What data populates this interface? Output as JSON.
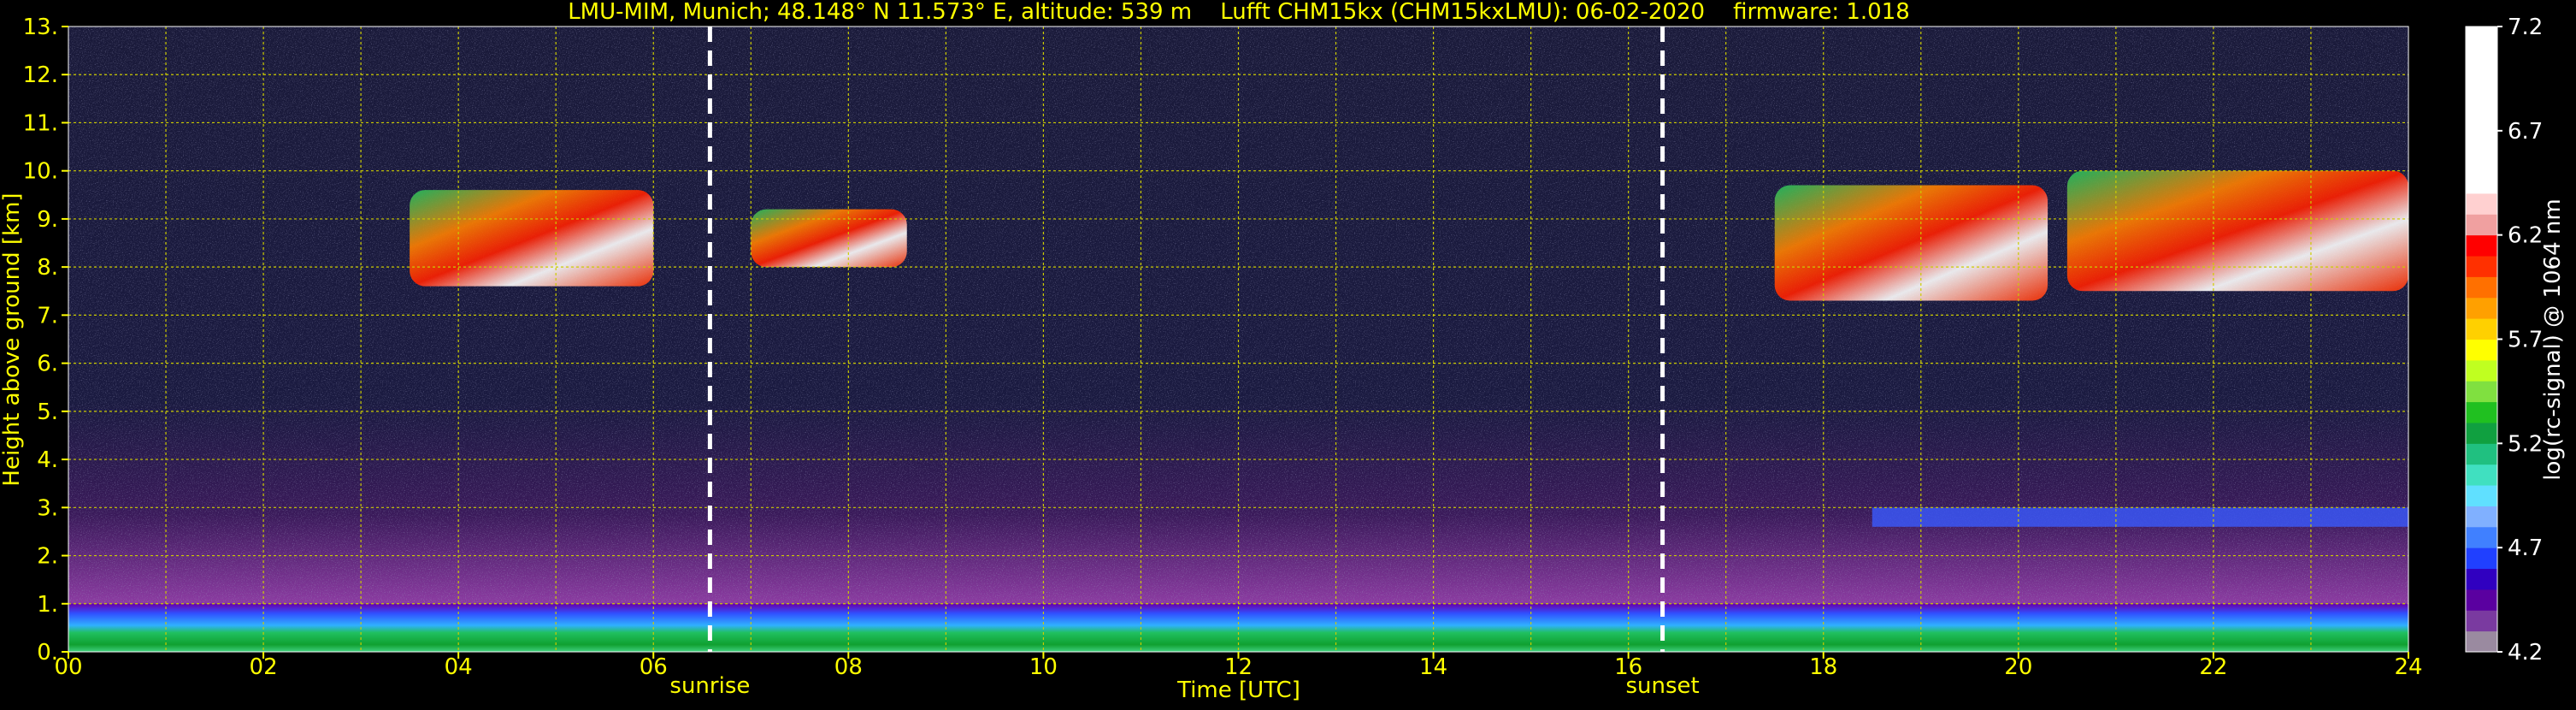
{
  "chart_data": {
    "type": "heatmap",
    "title": "LMU-MIM, Munich; 48.148° N 11.573° E, altitude: 539 m    Lufft CHM15kx (CHM15kxLMU): 06-02-2020    firmware: 1.018",
    "xlabel": "Time [UTC]",
    "ylabel": "Height above ground [km]",
    "xlim": [
      0,
      24
    ],
    "ylim": [
      0,
      13
    ],
    "x_ticks": [
      "00",
      "02",
      "04",
      "06",
      "08",
      "10",
      "12",
      "14",
      "16",
      "18",
      "20",
      "22",
      "24"
    ],
    "y_ticks": [
      "0.",
      "1.",
      "2.",
      "3.",
      "4.",
      "5.",
      "6.",
      "7.",
      "8.",
      "9.",
      "10.",
      "11.",
      "12.",
      "13."
    ],
    "grid": true,
    "markers": [
      {
        "label": "sunrise",
        "time": 6.58
      },
      {
        "label": "sunset",
        "time": 16.35
      }
    ],
    "colorbar": {
      "label": "log(rc-signal) @ 1064 nm",
      "range": [
        4.2,
        7.2
      ],
      "ticks": [
        "4.2",
        "4.7",
        "5.2",
        "5.7",
        "6.2",
        "6.7",
        "7.2"
      ]
    },
    "features": [
      {
        "name": "boundary layer",
        "t0": 0,
        "t1": 24,
        "h0": 0,
        "h1": 1.0
      },
      {
        "name": "cirrus",
        "t0": 3.5,
        "t1": 6.0,
        "h0": 7.6,
        "h1": 9.6
      },
      {
        "name": "cirrus",
        "t0": 7.0,
        "t1": 8.6,
        "h0": 8.0,
        "h1": 9.2
      },
      {
        "name": "cirrus",
        "t0": 17.5,
        "t1": 20.3,
        "h0": 7.3,
        "h1": 9.7
      },
      {
        "name": "cirrus",
        "t0": 20.5,
        "t1": 24.0,
        "h0": 7.5,
        "h1": 10.0
      },
      {
        "name": "aerosol layer",
        "t0": 18.5,
        "t1": 24.0,
        "h0": 2.6,
        "h1": 3.0
      }
    ]
  },
  "colors": {
    "background": "#000000",
    "text": "#ffff00",
    "grid": "#cccc00",
    "marker": "#ffffff"
  }
}
